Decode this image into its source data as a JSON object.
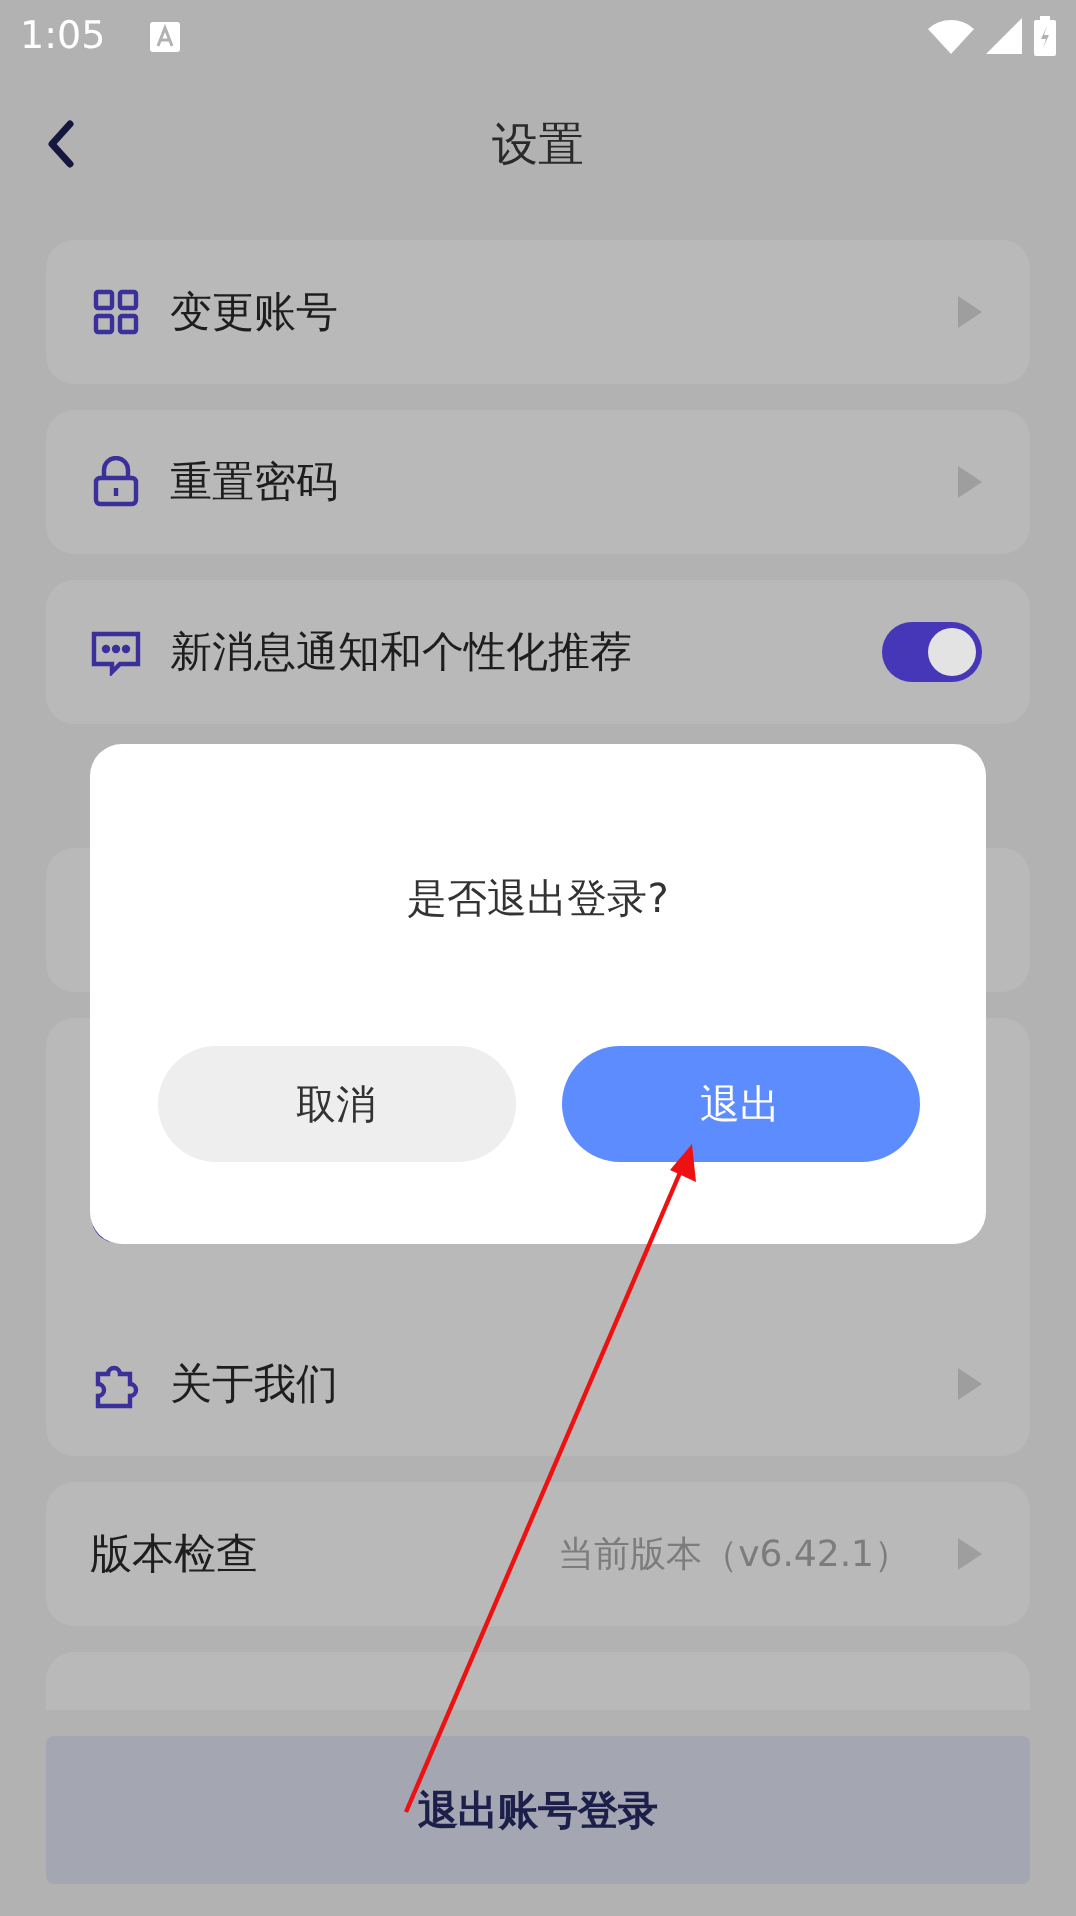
{
  "status_bar": {
    "time": "1:05"
  },
  "header": {
    "title": "设置"
  },
  "settings": [
    {
      "kind": "link",
      "label": "变更账号"
    },
    {
      "kind": "link",
      "label": "重置密码"
    },
    {
      "kind": "toggle",
      "label": "新消息通知和个性化推荐",
      "on": true
    },
    {
      "kind": "link",
      "label": "关于我们"
    },
    {
      "kind": "link",
      "label": "版本检查",
      "value": "当前版本（v6.42.1）"
    }
  ],
  "logout_button": "退出账号登录",
  "dialog": {
    "message": "是否退出登录?",
    "buttons": [
      {
        "kind": "secondary",
        "label": "取消"
      },
      {
        "kind": "primary",
        "label": "退出"
      }
    ]
  }
}
